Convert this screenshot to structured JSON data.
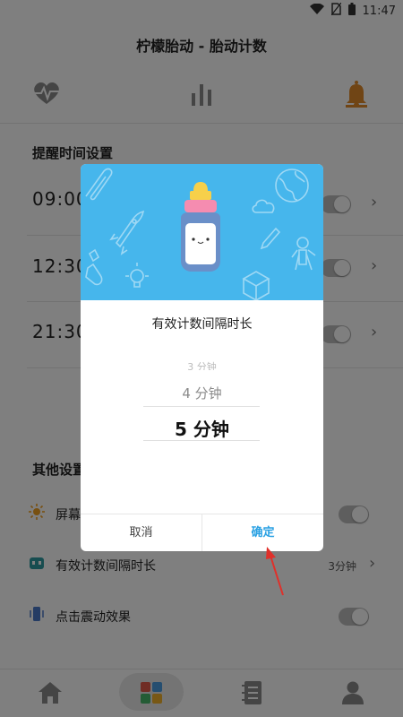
{
  "status_bar": {
    "time": "11:47",
    "icons": [
      "wifi-icon",
      "no-sim-icon",
      "battery-icon"
    ]
  },
  "app": {
    "title": "柠檬胎动 - 胎动计数"
  },
  "tabs": [
    {
      "icon": "heartbeat-icon"
    },
    {
      "icon": "bar-chart-icon"
    },
    {
      "icon": "bell-icon",
      "active": true,
      "accent": "#e08a2a"
    }
  ],
  "reminder_section": {
    "title": "提醒时间设置",
    "items": [
      {
        "time": "09:00"
      },
      {
        "time": "12:30"
      },
      {
        "time": "21:30"
      }
    ]
  },
  "other_section": {
    "title": "其他设置",
    "items": [
      {
        "icon": "sun-icon",
        "label": "屏幕"
      },
      {
        "icon": "interval-icon",
        "label": "有效计数间隔时长",
        "value": "3分钟"
      },
      {
        "icon": "vibration-icon",
        "label": "点击震动效果"
      }
    ]
  },
  "bottom_nav": [
    {
      "icon": "home-icon"
    },
    {
      "icon": "grid-icon",
      "active": true
    },
    {
      "icon": "notebook-icon"
    },
    {
      "icon": "person-icon"
    }
  ],
  "dialog": {
    "header_color": "#46b6ec",
    "title": "有效计数间隔时长",
    "picker": {
      "above_far": "3 分钟",
      "above": "4 分钟",
      "selected": "5 分钟"
    },
    "cancel_label": "取消",
    "confirm_label": "确定"
  },
  "annotation": {
    "arrow_color": "#e0302a"
  }
}
